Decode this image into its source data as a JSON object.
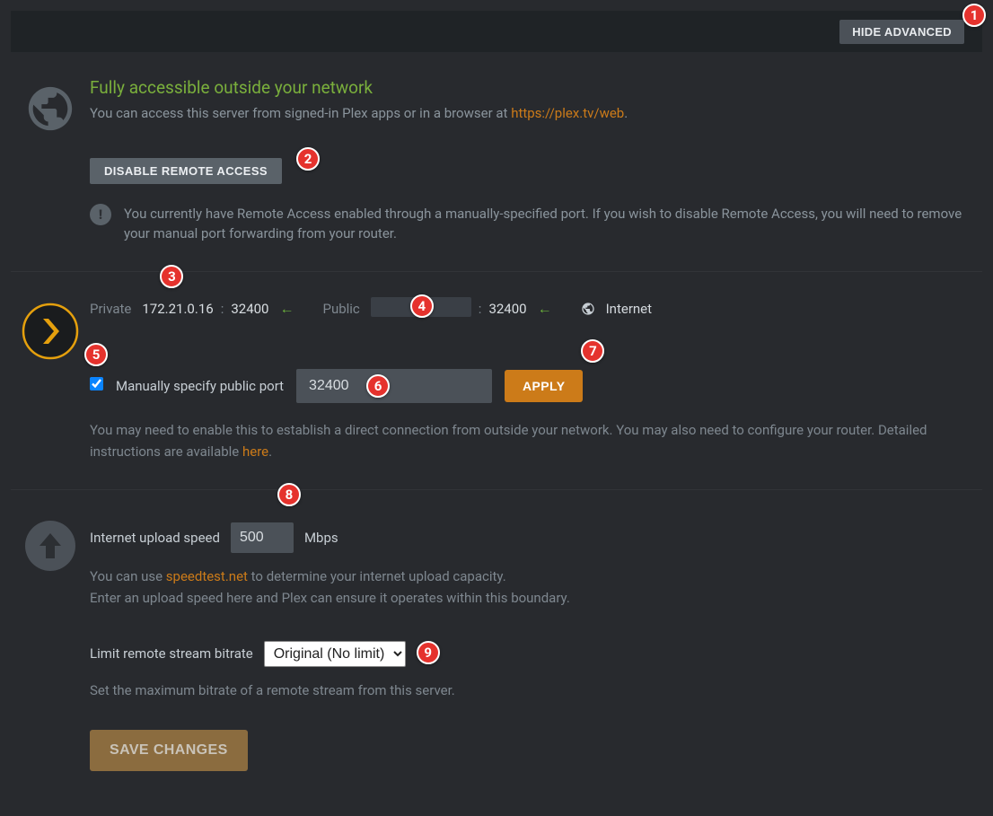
{
  "topbar": {
    "hide_advanced": "HIDE ADVANCED"
  },
  "access": {
    "title": "Fully accessible outside your network",
    "desc_prefix": "You can access this server from signed-in Plex apps or in a browser at ",
    "desc_link": "https://plex.tv/web",
    "disable_btn": "DISABLE REMOTE ACCESS",
    "info_text": "You currently have Remote Access enabled through a manually-specified port. If you wish to disable Remote Access, you will need to remove your manual port forwarding from your router."
  },
  "network": {
    "private_label": "Private",
    "private_ip": "172.21.0.16",
    "private_port": "32400",
    "public_label": "Public",
    "public_port": "32400",
    "internet_label": "Internet",
    "manual_port_label": "Manually specify public port",
    "manual_port_value": "32400",
    "apply_btn": "APPLY",
    "help_prefix": "You may need to enable this to establish a direct connection from outside your network. You may also need to configure your router. Detailed instructions are available ",
    "help_link": "here"
  },
  "upload": {
    "speed_label": "Internet upload speed",
    "speed_value": "500",
    "speed_unit": "Mbps",
    "speed_help_prefix": "You can use ",
    "speed_help_link": "speedtest.net",
    "speed_help_suffix": " to determine your internet upload capacity.",
    "speed_help_line2": "Enter an upload speed here and Plex can ensure it operates within this boundary.",
    "bitrate_label": "Limit remote stream bitrate",
    "bitrate_value": "Original (No limit)",
    "bitrate_help": "Set the maximum bitrate of a remote stream from this server."
  },
  "save_btn": "SAVE CHANGES",
  "badges": [
    "1",
    "2",
    "3",
    "4",
    "5",
    "6",
    "7",
    "8",
    "9"
  ]
}
